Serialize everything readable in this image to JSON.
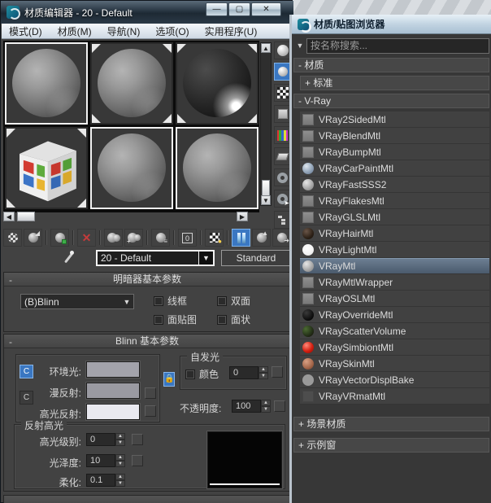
{
  "window": {
    "title": "材质编辑器 - 20 - Default",
    "menus": [
      "模式(D)",
      "材质(M)",
      "导航(N)",
      "选项(O)",
      "实用程序(U)"
    ],
    "controls": [
      "minimize",
      "maximize",
      "close"
    ],
    "control_glyphs": {
      "minimize": "—",
      "maximize": "▢",
      "close": "✕"
    }
  },
  "editor": {
    "sample_slots": [
      {
        "icon": "sphere-gray",
        "active_frame": true,
        "hot_corners": false
      },
      {
        "icon": "sphere-gray",
        "active_frame": false,
        "hot_corners": true
      },
      {
        "icon": "sphere-dark",
        "active_frame": false,
        "hot_corners": true
      },
      {
        "icon": "cube-windows-logo",
        "active_frame": false,
        "hot_corners": true
      },
      {
        "icon": "sphere-gray",
        "active_frame": true,
        "hot_corners": false
      },
      {
        "icon": "sphere-gray",
        "active_frame": true,
        "hot_corners": false
      }
    ],
    "vertical_toolbar": [
      "sample-type",
      "backlight",
      "background",
      "sample-uv-tiling",
      "video-color-check",
      "make-preview",
      "options",
      "select-by-material",
      "material-map-navigator"
    ],
    "vertical_toolbar_active": "backlight",
    "toolbar": [
      "get-material",
      "put-material-to-scene",
      "assign-material-to-selection",
      "reset-map-mtl",
      "make-material-copy",
      "make-unique",
      "put-to-library",
      "material-id-channel",
      "show-shaded-material-in-viewport",
      "show-end-result",
      "go-to-parent",
      "go-forward-to-sibling"
    ],
    "toolbar_active": "show-end-result",
    "material_id_value": "0",
    "picker": "pick-material-from-object",
    "material_name": "20 - Default",
    "type_button": "Standard",
    "signs": {
      "collapsed": "+",
      "expanded": "-"
    },
    "shader_rollout": {
      "title": "明暗器基本参数",
      "shader_value": "(B)Blinn",
      "checkboxes": [
        "线框",
        "双面",
        "面贴图",
        "面状"
      ]
    },
    "blinn_rollout": {
      "title": "Blinn 基本参数",
      "ambient_label": "环境光:",
      "diffuse_label": "漫反射:",
      "specular_label": "高光反射:",
      "ambient_color": "#a3a3ab",
      "diffuse_color": "#9a9aa2",
      "specular_color": "#e9e9f0",
      "self_illum_title": "自发光",
      "self_illum_color_label": "颜色",
      "self_illum_value": "0",
      "opacity_label": "不透明度:",
      "opacity_value": "100"
    },
    "highlights_group": {
      "title": "反射高光",
      "level_label": "高光级别:",
      "level_value": "0",
      "gloss_label": "光泽度:",
      "gloss_value": "10",
      "soften_label": "柔化:",
      "soften_value": "0.1"
    }
  },
  "browser": {
    "title": "材质/贴图浏览器",
    "search_placeholder": "按名称搜索...",
    "groups": {
      "materials": {
        "sign": "-",
        "label": "材质"
      },
      "standard": {
        "sign": "+",
        "label": "标准"
      },
      "vray": {
        "sign": "-",
        "label": "V-Ray"
      },
      "scene_materials": {
        "sign": "+",
        "label": "场景材质"
      },
      "sample_windows": {
        "sign": "+",
        "label": "示例窗"
      }
    },
    "vray_items": [
      {
        "label": "VRay2SidedMtl",
        "icon": "square-gray"
      },
      {
        "label": "VRayBlendMtl",
        "icon": "square-gray"
      },
      {
        "label": "VRayBumpMtl",
        "icon": "square-gray"
      },
      {
        "label": "VRayCarPaintMtl",
        "icon": "sphere-blue-gray"
      },
      {
        "label": "VRayFastSSS2",
        "icon": "sphere-gray"
      },
      {
        "label": "VRayFlakesMtl",
        "icon": "square-gray"
      },
      {
        "label": "VRayGLSLMtl",
        "icon": "square-gray"
      },
      {
        "label": "VRayHairMtl",
        "icon": "sphere-dark-brown"
      },
      {
        "label": "VRayLightMtl",
        "icon": "sphere-white"
      },
      {
        "label": "VRayMtl",
        "icon": "sphere-gray",
        "selected": true
      },
      {
        "label": "VRayMtlWrapper",
        "icon": "square-gray"
      },
      {
        "label": "VRayOSLMtl",
        "icon": "square-gray"
      },
      {
        "label": "VRayOverrideMtl",
        "icon": "sphere-black"
      },
      {
        "label": "VRayScatterVolume",
        "icon": "sphere-scatter-green-red"
      },
      {
        "label": "VRaySimbiontMtl",
        "icon": "sphere-red"
      },
      {
        "label": "VRaySkinMtl",
        "icon": "sphere-skin"
      },
      {
        "label": "VRayVectorDisplBake",
        "icon": "sphere-flat-gray"
      },
      {
        "label": "VRayVRmatMtl",
        "icon": "square-dark-gray"
      }
    ],
    "selected_item": "VRayMtl"
  },
  "colors": {
    "selection": "#5a6b7d",
    "toolbar_active": "#3a77c2",
    "titlebar_dark": "#2b3946",
    "panel_bg": "#424242"
  }
}
